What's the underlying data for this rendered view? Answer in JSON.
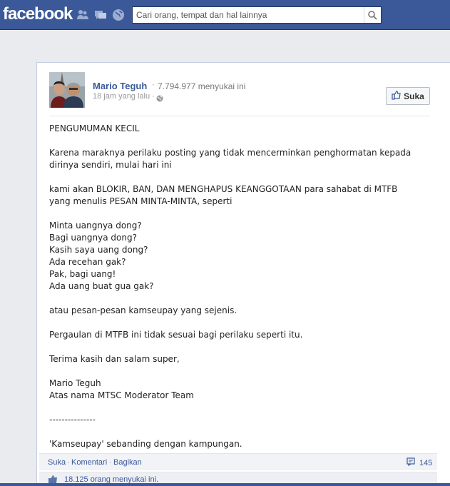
{
  "header": {
    "logo": "facebook",
    "search": {
      "placeholder": "Cari orang, tempat dan hal lainnya",
      "value": ""
    },
    "jewels": [
      "friend-requests-icon",
      "messages-icon",
      "notifications-globe-icon"
    ],
    "search_icon": "search-icon"
  },
  "post": {
    "author": "Mario Teguh",
    "separator": "·",
    "page_likes": "7.794.977 menyukai ini",
    "timestamp": "18 jam yang lalu ·",
    "like_page_button": "Suka",
    "body": [
      "PENGUMUMAN KECIL",
      "",
      "Karena maraknya perilaku posting yang tidak mencerminkan penghormatan kepada dirinya sendiri, mulai hari ini",
      "",
      "kami akan BLOKIR, BAN, DAN MENGHAPUS KEANGGOTAAN para sahabat di MTFB yang menulis PESAN MINTA-MINTA, seperti",
      "",
      "Minta uangnya dong?",
      "Bagi uangnya dong?",
      "Kasih saya uang dong?",
      "Ada recehan gak?",
      "Pak, bagi uang!",
      "Ada uang buat gua gak?",
      "",
      "atau pesan-pesan kamseupay yang sejenis.",
      "",
      "Pergaulan di MTFB ini tidak sesuai bagi perilaku seperti itu.",
      "",
      "Terima kasih dan salam super,",
      "",
      "Mario Teguh",
      "Atas nama MTSC Moderator Team",
      "",
      "---------------",
      "",
      "'Kamseupay' sebanding dengan kampungan."
    ],
    "actions": {
      "like": "Suka",
      "comment": "Komentari",
      "share": "Bagikan",
      "dot": "·"
    },
    "share_count": "145",
    "likes_summary": "18.125 orang menyukai ini."
  },
  "colors": {
    "brand": "#3b5998",
    "background": "#e9ebee"
  }
}
